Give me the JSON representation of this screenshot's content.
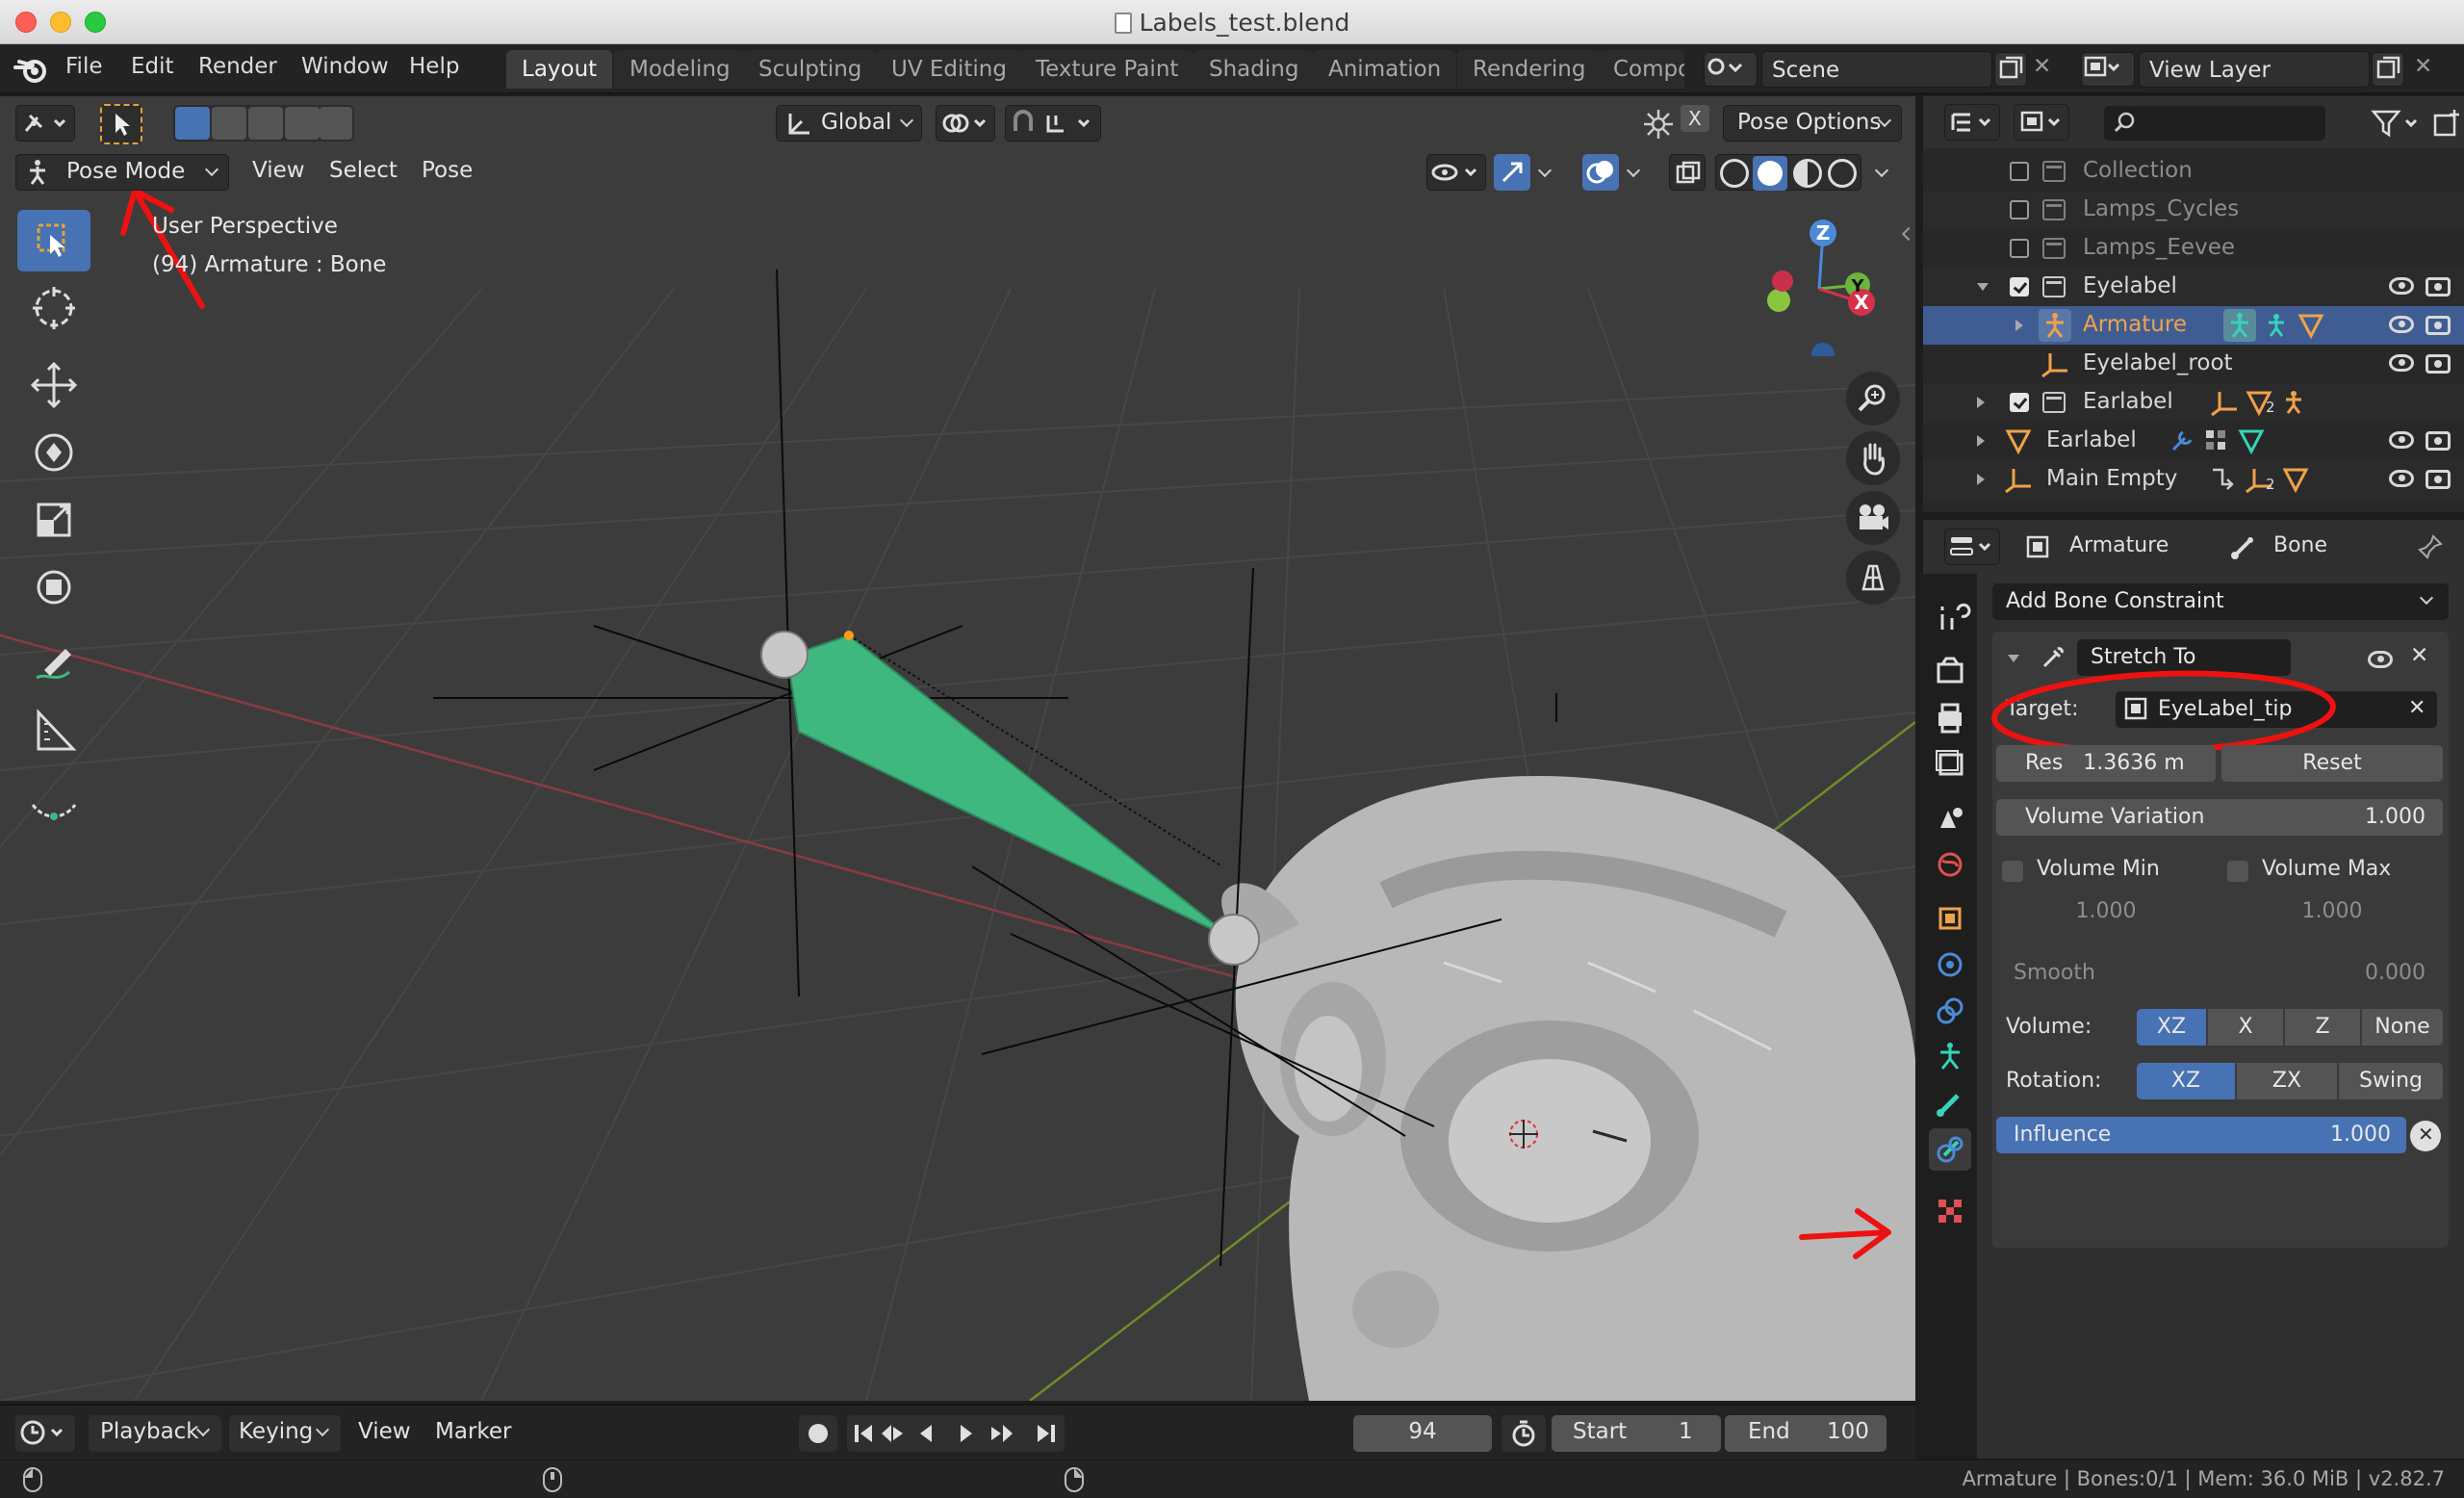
{
  "window": {
    "title": "Labels_test.blend"
  },
  "topbar": {
    "menus": [
      "File",
      "Edit",
      "Render",
      "Window",
      "Help"
    ],
    "workspaces": [
      "Layout",
      "Modeling",
      "Sculpting",
      "UV Editing",
      "Texture Paint",
      "Shading",
      "Animation",
      "Rendering",
      "Compo"
    ],
    "active_workspace": "Layout",
    "scene": "Scene",
    "view_layer": "View Layer"
  },
  "viewport": {
    "transform_orientation": "Global",
    "pose_options": "Pose Options",
    "mode": "Pose Mode",
    "menus": [
      "View",
      "Select",
      "Pose"
    ],
    "overlay_line1": "User Perspective",
    "overlay_line2": "(94) Armature : Bone",
    "gizmo_axes": [
      "Z",
      "Y",
      "X"
    ],
    "close_x": "X"
  },
  "outliner": {
    "rows": [
      {
        "label": "Collection",
        "type": "collection",
        "checked": false,
        "dim": true
      },
      {
        "label": "Lamps_Cycles",
        "type": "collection",
        "checked": false,
        "dim": true
      },
      {
        "label": "Lamps_Eevee",
        "type": "collection",
        "checked": false,
        "dim": true
      },
      {
        "label": "Eyelabel",
        "type": "collection",
        "checked": true,
        "dim": false
      },
      {
        "label": "Armature",
        "type": "armature",
        "selected": true
      },
      {
        "label": "Eyelabel_root",
        "type": "empty"
      },
      {
        "label": "Earlabel",
        "type": "collection",
        "checked": true,
        "dim": false
      },
      {
        "label": "Earlabel",
        "type": "mesh"
      },
      {
        "label": "Main Empty",
        "type": "empty"
      }
    ],
    "subscript_2": "2"
  },
  "properties": {
    "breadcrumb_object": "Armature",
    "breadcrumb_bone": "Bone",
    "add_constraint": "Add Bone Constraint",
    "constraint_name": "Stretch To",
    "target_label": "Target:",
    "target_value": "EyeLabel_tip",
    "rest_label": "Res",
    "rest_value": "1.3636 m",
    "reset": "Reset",
    "volume_variation_label": "Volume Variation",
    "volume_variation_value": "1.000",
    "volume_min_label": "Volume Min",
    "volume_max_label": "Volume Max",
    "volume_min_value": "1.000",
    "volume_max_value": "1.000",
    "smooth_label": "Smooth",
    "smooth_value": "0.000",
    "volume_label": "Volume:",
    "volume_options": [
      "XZ",
      "X",
      "Z",
      "None"
    ],
    "rotation_label": "Rotation:",
    "rotation_options": [
      "XZ",
      "ZX",
      "Swing"
    ],
    "influence_label": "Influence",
    "influence_value": "1.000"
  },
  "timeline": {
    "menus": [
      "Playback",
      "Keying",
      "View",
      "Marker"
    ],
    "current_frame": "94",
    "start_label": "Start",
    "start_value": "1",
    "end_label": "End",
    "end_value": "100"
  },
  "status": {
    "text": "Armature | Bones:0/1 | Mem: 36.0 MiB | v2.82.7"
  },
  "colors": {
    "accent": "#4772b3",
    "bone": "#3fb87f",
    "annotation": "#ee1111",
    "armature": "#f0a24a"
  }
}
